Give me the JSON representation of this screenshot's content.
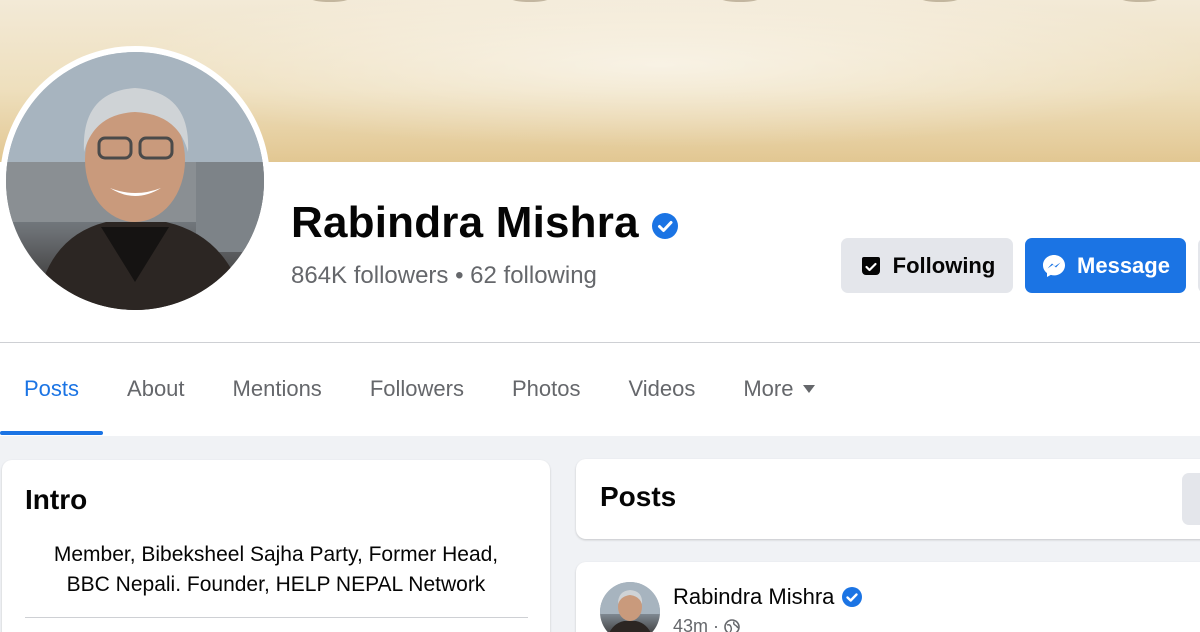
{
  "profile": {
    "name": "Rabindra Mishra",
    "stats": "864K followers • 62 following"
  },
  "actions": {
    "following_label": "Following",
    "message_label": "Message"
  },
  "tabs": [
    {
      "label": "Posts",
      "active": true
    },
    {
      "label": "About"
    },
    {
      "label": "Mentions"
    },
    {
      "label": "Followers"
    },
    {
      "label": "Photos"
    },
    {
      "label": "Videos"
    },
    {
      "label": "More"
    }
  ],
  "intro": {
    "title": "Intro",
    "bio_line1": "Member, Bibeksheel Sajha Party, Former Head,",
    "bio_line2": "BBC Nepali. Founder, HELP NEPAL Network"
  },
  "posts_section": {
    "title": "Posts"
  },
  "post": {
    "author": "Rabindra Mishra",
    "time": "43m",
    "separator": "·",
    "audience_icon": "globe-icon"
  },
  "colors": {
    "accent": "#1b74e4",
    "secondary_text": "#65676b",
    "button_gray": "#e4e6eb"
  }
}
